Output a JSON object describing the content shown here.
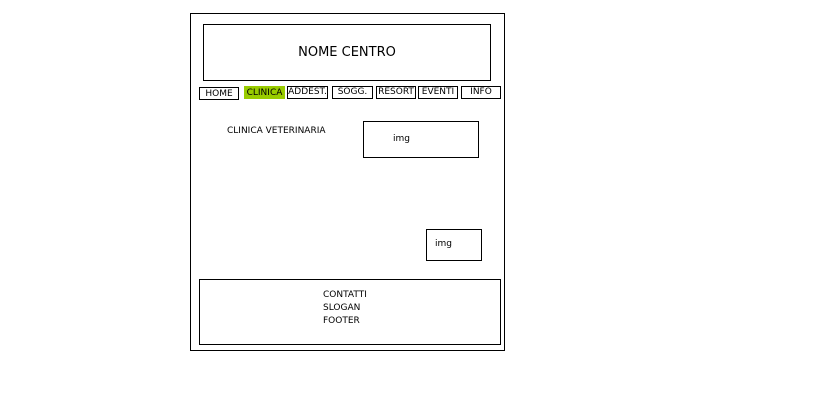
{
  "header": {
    "title": "NOME CENTRO"
  },
  "nav": {
    "items": [
      {
        "label": "HOME",
        "active": false
      },
      {
        "label": "CLINICA",
        "active": true
      },
      {
        "label": "ADDEST.",
        "active": false
      },
      {
        "label": "SOGG.",
        "active": false
      },
      {
        "label": "RESORT",
        "active": false
      },
      {
        "label": "EVENTI",
        "active": false
      },
      {
        "label": "INFO",
        "active": false
      }
    ]
  },
  "colors": {
    "active_nav": "#99cc00",
    "border": "#000000"
  },
  "main": {
    "section_title": "CLINICA VETERINARIA",
    "images": [
      {
        "label": "img"
      },
      {
        "label": "img"
      }
    ]
  },
  "footer": {
    "lines": [
      "CONTATTI",
      "SLOGAN",
      "FOOTER"
    ]
  }
}
